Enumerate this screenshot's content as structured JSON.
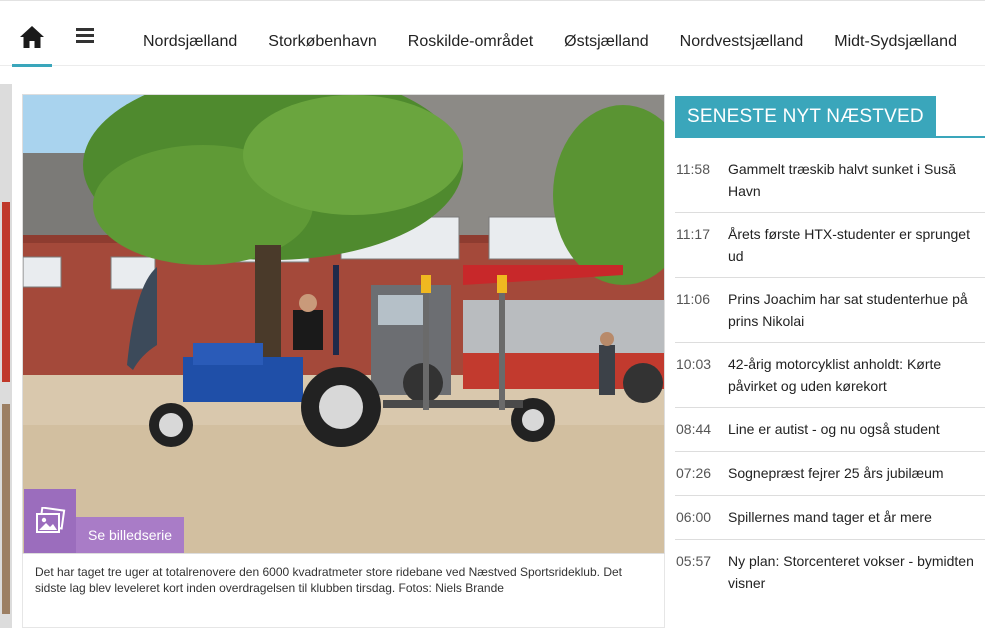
{
  "nav": {
    "home_icon": "home-icon",
    "menu_icon": "hamburger-icon",
    "accent": "#3aa6bb",
    "links": [
      "Nordsjælland",
      "Storkøbenhavn",
      "Roskilde-området",
      "Østsjælland",
      "Nordvestsjælland",
      "Midt-Sydsjælland"
    ]
  },
  "article": {
    "gallery_icon": "photo-gallery-icon",
    "gallery_label": "Se billedserie",
    "gallery_color": "#9b6dbd",
    "caption": "Det har taget tre uger at totalrenovere den 6000 kvadratmeter store ridebane ved Næstved Sportsrideklub. Det sidste lag blev leveleret kort inden overdragelsen til klubben tirsdag. Fotos: Niels Brande"
  },
  "news": {
    "heading": "SENESTE NYT NÆSTVED",
    "items": [
      {
        "time": "11:58",
        "title": "Gammelt træskib halvt sunket i Susă Havn"
      },
      {
        "time": "11:17",
        "title": "Årets første HTX-studenter er sprunget ud"
      },
      {
        "time": "11:06",
        "title": "Prins Joachim har sat studenterhue på prins Nikolai"
      },
      {
        "time": "10:03",
        "title": "42-årig motorcyklist anholdt: Kørte påvirket og uden kørekort"
      },
      {
        "time": "08:44",
        "title": "Line er autist - og nu også student"
      },
      {
        "time": "07:26",
        "title": "Sognepræst fejrer 25 års jubilæum"
      },
      {
        "time": "06:00",
        "title": "Spillernes mand tager et år mere"
      },
      {
        "time": "05:57",
        "title": "Ny plan: Storcenteret vokser - bymidten visner"
      }
    ]
  }
}
